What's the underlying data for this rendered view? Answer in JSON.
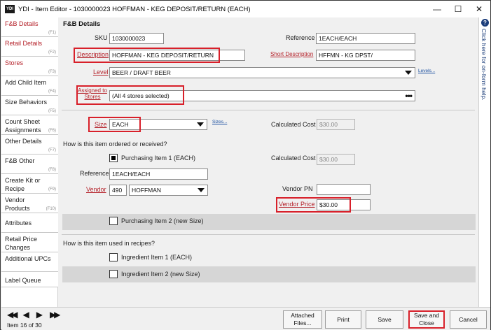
{
  "window": {
    "app_icon": "YDI",
    "title": "YDI - Item Editor - 1030000023 HOFFMAN - KEG DEPOSIT/RETURN (EACH)",
    "minimize": "—",
    "maximize": "☐",
    "close": "✕"
  },
  "sidebar": {
    "items": [
      {
        "label": "F&B Details",
        "key": "(F1)"
      },
      {
        "label": "Retail Details",
        "key": "(F2)"
      },
      {
        "label": "Stores",
        "key": "(F3)"
      },
      {
        "label": "Add Child Item",
        "key": "(F4)"
      },
      {
        "label": "Size Behaviors",
        "key": "(F5)"
      },
      {
        "label": "Count Sheet Assignments",
        "key": "(F6)"
      },
      {
        "label": "Other Details",
        "key": "(F7)"
      },
      {
        "label": "F&B Other",
        "key": "(F8)"
      },
      {
        "label": "Create Kit or Recipe",
        "key": "(F9)"
      },
      {
        "label": "Vendor Products",
        "key": "(F10)"
      },
      {
        "label": "Attributes",
        "key": ""
      },
      {
        "label": "Retail Price Changes",
        "key": ""
      },
      {
        "label": "Additional UPCs",
        "key": ""
      },
      {
        "label": "Label Queue",
        "key": ""
      }
    ]
  },
  "help": {
    "icon": "?",
    "text": "Click here for on-form help."
  },
  "form": {
    "section_title": "F&B Details",
    "sku_label": "SKU",
    "sku_value": "1030000023",
    "reference_label": "Reference",
    "reference_value": "1EACH/EACH",
    "description_label": "Description",
    "description_value": "HOFFMAN - KEG DEPOSIT/RETURN",
    "short_description_label": "Short Description",
    "short_description_value": "HFFMN - KG DPST/",
    "level_label": "Level",
    "level_value": "BEER / DRAFT BEER",
    "levels_link": "Levels...",
    "assigned_label_1": "Assigned to",
    "assigned_label_2": "Stores",
    "assigned_value": "(All 4 stores selected)",
    "assigned_dots": "•••",
    "size_label": "Size",
    "size_value": "EACH",
    "sizes_link": "Sizes...",
    "calc_cost_label": "Calculated Cost",
    "calc_cost_value": "$30.00",
    "ordered_question": "How is this item ordered or received?",
    "purchasing_item_1": "Purchasing Item 1 (EACH)",
    "calc_cost_label_2": "Calculated Cost",
    "calc_cost_value_2": "$30.00",
    "reference_label_2": "Reference",
    "reference_value_2": "1EACH/EACH",
    "vendor_label": "Vendor",
    "vendor_code": "490",
    "vendor_name": "HOFFMAN",
    "vendor_pn_label": "Vendor PN",
    "vendor_pn_value": "",
    "vendor_price_label": "Vendor Price",
    "vendor_price_value": "$30.00",
    "purchasing_item_2": "Purchasing Item 2 (new Size)",
    "recipes_question": "How is this item used in recipes?",
    "ingredient_item_1": "Ingredient Item 1 (EACH)",
    "ingredient_item_2": "Ingredient Item 2 (new Size)"
  },
  "footer": {
    "nav_first": "◀◀",
    "nav_prev": "◀",
    "nav_next": "▶",
    "nav_last": "▶▶",
    "item_count": "Item 16 of 30",
    "attached_files": "Attached Files...",
    "print": "Print",
    "save": "Save",
    "save_close": "Save and Close",
    "cancel": "Cancel"
  },
  "colors": {
    "highlight": "#d8202a",
    "active_tab": "#b5232b",
    "link": "#1a4fa0"
  }
}
